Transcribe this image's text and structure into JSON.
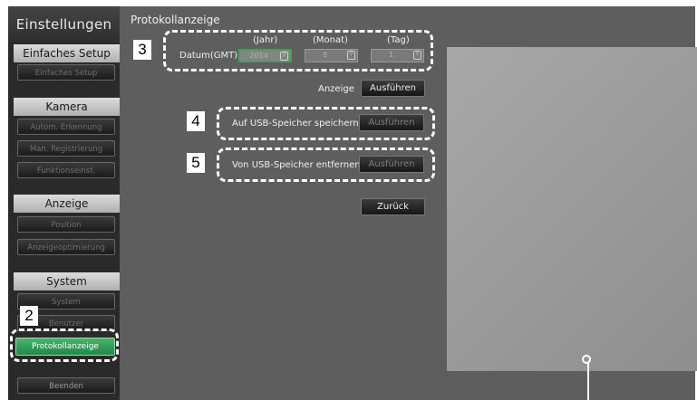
{
  "sidebar": {
    "title": "Einstellungen",
    "sections": {
      "setup": {
        "header": "Einfaches Setup",
        "items": [
          "Einfaches Setup"
        ]
      },
      "camera": {
        "header": "Kamera",
        "items": [
          "Autom. Erkennung",
          "Man. Registrierung",
          "Funktionseinst."
        ]
      },
      "display": {
        "header": "Anzeige",
        "items": [
          "Position",
          "Anzeigeoptimierung"
        ]
      },
      "system": {
        "header": "System",
        "items": [
          "System",
          "Benutzer",
          "Protokollanzeige"
        ]
      }
    },
    "exit_label": "Beenden"
  },
  "main": {
    "title": "Protokollanzeige",
    "date": {
      "label": "Datum(GMT)",
      "year_label": "(Jahr)",
      "month_label": "(Monat)",
      "day_label": "(Tag)",
      "year_value": "2014",
      "month_value": "8",
      "day_value": "1",
      "spin_symbol": "◊"
    },
    "show": {
      "label": "Anzeige",
      "button": "Ausführen"
    },
    "usb_save": {
      "label": "Auf USB-Speicher speichern",
      "button": "Ausführen"
    },
    "usb_remove": {
      "label": "Von USB-Speicher entfernen",
      "button": "Ausführen"
    },
    "back_button": "Zurück"
  },
  "callouts": {
    "n2": "2",
    "n3": "3",
    "n4": "4",
    "n5": "5"
  },
  "colors": {
    "active_green": "#2f9a55",
    "panel_bg": "#5e5e5e",
    "sidebar_bg": "#2a2a2a"
  }
}
